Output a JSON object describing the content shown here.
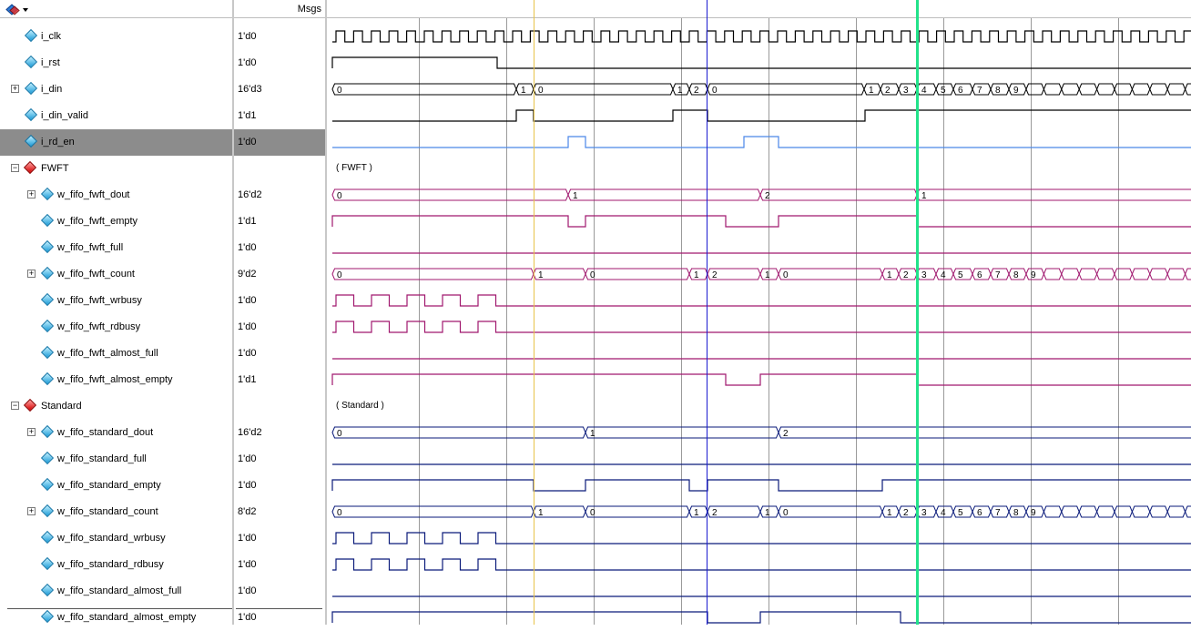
{
  "header": {
    "msgs_label": "Msgs",
    "menu_icon": "diamond-dropdown-icon"
  },
  "signals": [
    {
      "name": "i_clk",
      "value": "1'd0",
      "indent": 1,
      "icon": "blue-diamond-icon",
      "expandable": false,
      "color": "#000000"
    },
    {
      "name": "i_rst",
      "value": "1'd0",
      "indent": 1,
      "icon": "blue-diamond-icon",
      "expandable": false,
      "color": "#000000"
    },
    {
      "name": "i_din",
      "value": "16'd3",
      "indent": 1,
      "icon": "blue-diamond-icon",
      "expandable": true,
      "color": "#000000"
    },
    {
      "name": "i_din_valid",
      "value": "1'd1",
      "indent": 1,
      "icon": "blue-diamond-icon",
      "expandable": false,
      "color": "#000000"
    },
    {
      "name": "i_rd_en",
      "value": "1'd0",
      "indent": 1,
      "icon": "blue-diamond-icon",
      "expandable": false,
      "selected": true,
      "color": "#4a86e8"
    },
    {
      "name": "FWFT",
      "value": "",
      "indent": 0,
      "group": true,
      "icon": "red-diamond-icon",
      "expandable": true,
      "color": "#000000"
    },
    {
      "name": "w_fifo_fwft_dout",
      "value": "16'd2",
      "indent": 2,
      "icon": "blue-diamond-icon",
      "expandable": true,
      "color": "#a0176e"
    },
    {
      "name": "w_fifo_fwft_empty",
      "value": "1'd1",
      "indent": 2,
      "icon": "blue-diamond-icon",
      "expandable": false,
      "color": "#a0176e"
    },
    {
      "name": "w_fifo_fwft_full",
      "value": "1'd0",
      "indent": 2,
      "icon": "blue-diamond-icon",
      "expandable": false,
      "color": "#a0176e"
    },
    {
      "name": "w_fifo_fwft_count",
      "value": "9'd2",
      "indent": 2,
      "icon": "blue-diamond-icon",
      "expandable": true,
      "color": "#a0176e"
    },
    {
      "name": "w_fifo_fwft_wrbusy",
      "value": "1'd0",
      "indent": 2,
      "icon": "blue-diamond-icon",
      "expandable": false,
      "color": "#a0176e"
    },
    {
      "name": "w_fifo_fwft_rdbusy",
      "value": "1'd0",
      "indent": 2,
      "icon": "blue-diamond-icon",
      "expandable": false,
      "color": "#a0176e"
    },
    {
      "name": "w_fifo_fwft_almost_full",
      "value": "1'd0",
      "indent": 2,
      "icon": "blue-diamond-icon",
      "expandable": false,
      "color": "#a0176e"
    },
    {
      "name": "w_fifo_fwft_almost_empty",
      "value": "1'd1",
      "indent": 2,
      "icon": "blue-diamond-icon",
      "expandable": false,
      "color": "#a0176e"
    },
    {
      "name": "Standard",
      "value": "",
      "indent": 0,
      "group": true,
      "icon": "red-diamond-icon",
      "expandable": true,
      "color": "#000000"
    },
    {
      "name": "w_fifo_standard_dout",
      "value": "16'd2",
      "indent": 2,
      "icon": "blue-diamond-icon",
      "expandable": true,
      "color": "#0a1a7a"
    },
    {
      "name": "w_fifo_standard_full",
      "value": "1'd0",
      "indent": 2,
      "icon": "blue-diamond-icon",
      "expandable": false,
      "color": "#0a1a7a"
    },
    {
      "name": "w_fifo_standard_empty",
      "value": "1'd0",
      "indent": 2,
      "icon": "blue-diamond-icon",
      "expandable": false,
      "color": "#0a1a7a"
    },
    {
      "name": "w_fifo_standard_count",
      "value": "8'd2",
      "indent": 2,
      "icon": "blue-diamond-icon",
      "expandable": true,
      "color": "#0a1a7a"
    },
    {
      "name": "w_fifo_standard_wrbusy",
      "value": "1'd0",
      "indent": 2,
      "icon": "blue-diamond-icon",
      "expandable": false,
      "color": "#0a1a7a"
    },
    {
      "name": "w_fifo_standard_rdbusy",
      "value": "1'd0",
      "indent": 2,
      "icon": "blue-diamond-icon",
      "expandable": false,
      "color": "#0a1a7a"
    },
    {
      "name": "w_fifo_standard_almost_full",
      "value": "1'd0",
      "indent": 2,
      "icon": "blue-diamond-icon",
      "expandable": false,
      "color": "#0a1a7a"
    },
    {
      "name": "w_fifo_standard_almost_empty",
      "value": "1'd0",
      "indent": 2,
      "icon": "blue-diamond-icon",
      "expandable": false,
      "color": "#0a1a7a"
    }
  ],
  "group_labels": {
    "fwft": "( FWFT )",
    "standard": "( Standard )"
  },
  "bus_values": {
    "i_din": [
      "0",
      "1",
      "0",
      "1",
      "2",
      "0",
      "1",
      "2",
      "3",
      "4",
      "5",
      "6",
      "7",
      "8",
      "9"
    ],
    "w_fifo_fwft_dout": [
      "0",
      "1",
      "2",
      "1"
    ],
    "w_fifo_fwft_count": [
      "0",
      "1",
      "0",
      "1",
      "2",
      "1",
      "0",
      "1",
      "2",
      "3",
      "4",
      "5",
      "6",
      "7",
      "8",
      "9"
    ],
    "w_fifo_standard_dout": [
      "0",
      "1",
      "2"
    ],
    "w_fifo_standard_count": [
      "0",
      "1",
      "0",
      "1",
      "2",
      "1",
      "0",
      "1",
      "2",
      "3",
      "4",
      "5",
      "6",
      "7",
      "8",
      "9"
    ]
  },
  "colors": {
    "cursor_yellow": "#e8c44a",
    "cursor_blue": "#1a1ad0",
    "cursor_green": "#22e28a",
    "grid": "#9a9a9a",
    "selected_row": "#8c8c8c"
  }
}
